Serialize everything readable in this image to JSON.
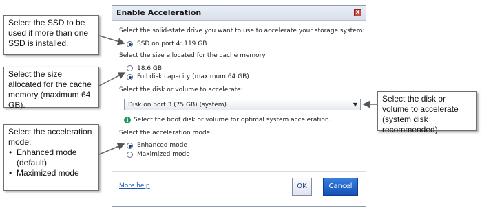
{
  "callouts": {
    "ssd": "Select the SSD to be used if more than one SSD is installed.",
    "size": "Select the size allocated for the cache memory (maximum 64 GB).",
    "mode_title": "Select the acceleration mode:",
    "mode_items": [
      "Enhanced mode (default)",
      "Maximized mode"
    ],
    "volume": "Select the disk or volume to accelerate (system disk recommended)."
  },
  "dialog": {
    "title": "Enable Acceleration",
    "close_glyph": "x",
    "ssd_prompt": "Select the solid-state drive you want to use to accelerate your storage system:",
    "ssd_option": "SSD on port 4: 119 GB",
    "size_prompt": "Select the size allocated for the cache memory:",
    "size_options": [
      "18.6 GB",
      "Full disk capacity (maximum 64 GB)"
    ],
    "volume_prompt": "Select the disk or volume to accelerate:",
    "volume_selected": "Disk on port 3 (75 GB) (system)",
    "info_icon": "info-icon",
    "info_glyph": "i",
    "info_text": "Select the boot disk or volume for optimal system acceleration.",
    "mode_prompt": "Select the acceleration mode:",
    "mode_options": [
      "Enhanced mode",
      "Maximized mode"
    ],
    "more_help": "More help",
    "ok": "OK",
    "cancel": "Cancel"
  },
  "state": {
    "ssd_selected": 0,
    "size_selected": 1,
    "mode_selected": 0
  },
  "colors": {
    "accent": "#1452b8",
    "link": "#1e56b8",
    "info": "#1f9a5e",
    "close": "#c94a3e"
  }
}
